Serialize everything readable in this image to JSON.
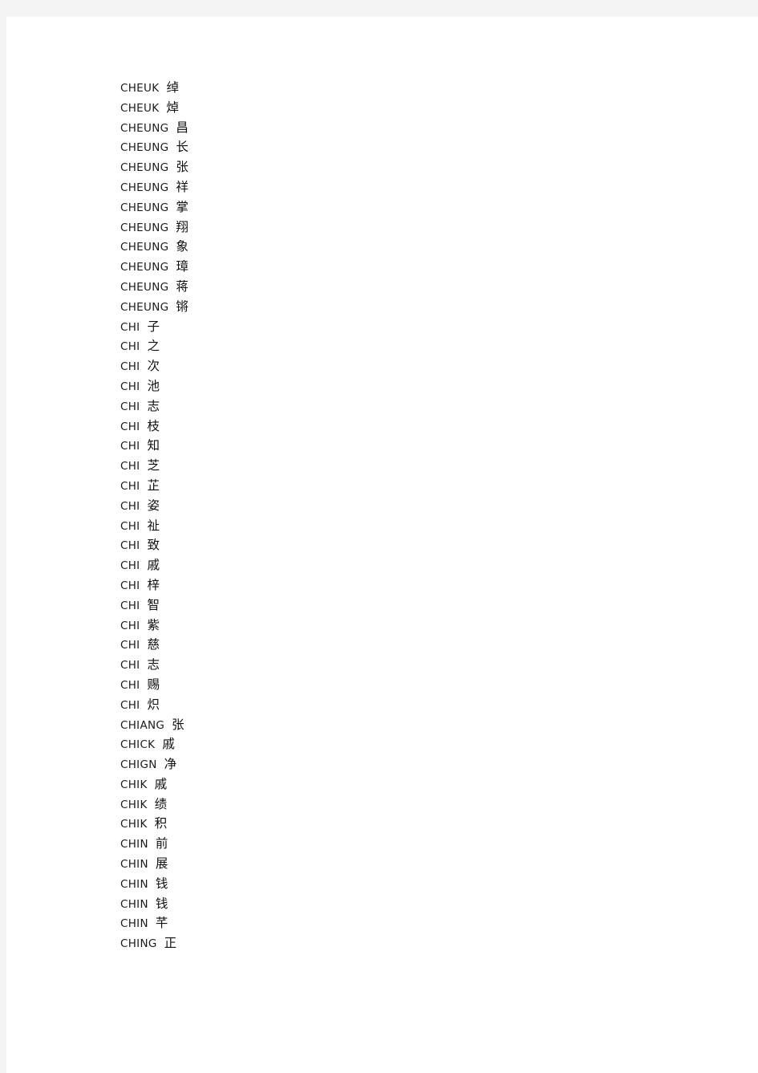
{
  "page": {
    "background_color": "#f4f4f4",
    "paper_color": "#ffffff",
    "text_color": "#1a1a1a"
  },
  "list": {
    "entries": [
      {
        "romanization": "CHEUK",
        "hanzi": "绰"
      },
      {
        "romanization": "CHEUK",
        "hanzi": "焯"
      },
      {
        "romanization": "CHEUNG",
        "hanzi": "昌"
      },
      {
        "romanization": "CHEUNG",
        "hanzi": "长"
      },
      {
        "romanization": "CHEUNG",
        "hanzi": "张"
      },
      {
        "romanization": "CHEUNG",
        "hanzi": "祥"
      },
      {
        "romanization": "CHEUNG",
        "hanzi": "掌"
      },
      {
        "romanization": "CHEUNG",
        "hanzi": "翔"
      },
      {
        "romanization": "CHEUNG",
        "hanzi": "象"
      },
      {
        "romanization": "CHEUNG",
        "hanzi": "璋"
      },
      {
        "romanization": "CHEUNG",
        "hanzi": "蒋"
      },
      {
        "romanization": "CHEUNG",
        "hanzi": "锵"
      },
      {
        "romanization": "CHI",
        "hanzi": "子"
      },
      {
        "romanization": "CHI",
        "hanzi": "之"
      },
      {
        "romanization": "CHI",
        "hanzi": "次"
      },
      {
        "romanization": "CHI",
        "hanzi": "池"
      },
      {
        "romanization": "CHI",
        "hanzi": "志"
      },
      {
        "romanization": "CHI",
        "hanzi": "枝"
      },
      {
        "romanization": "CHI",
        "hanzi": "知"
      },
      {
        "romanization": "CHI",
        "hanzi": "芝"
      },
      {
        "romanization": "CHI",
        "hanzi": "芷"
      },
      {
        "romanization": "CHI",
        "hanzi": "姿"
      },
      {
        "romanization": "CHI",
        "hanzi": "祉"
      },
      {
        "romanization": "CHI",
        "hanzi": "致"
      },
      {
        "romanization": "CHI",
        "hanzi": "戚"
      },
      {
        "romanization": "CHI",
        "hanzi": "梓"
      },
      {
        "romanization": "CHI",
        "hanzi": "智"
      },
      {
        "romanization": "CHI",
        "hanzi": "紫"
      },
      {
        "romanization": "CHI",
        "hanzi": "慈"
      },
      {
        "romanization": "CHI",
        "hanzi": "志"
      },
      {
        "romanization": "CHI",
        "hanzi": "赐"
      },
      {
        "romanization": "CHI",
        "hanzi": "炽"
      },
      {
        "romanization": "CHIANG",
        "hanzi": "张"
      },
      {
        "romanization": "CHICK",
        "hanzi": "戚"
      },
      {
        "romanization": "CHIGN",
        "hanzi": "净"
      },
      {
        "romanization": "CHIK",
        "hanzi": "戚"
      },
      {
        "romanization": "CHIK",
        "hanzi": "绩"
      },
      {
        "romanization": "CHIK",
        "hanzi": "积"
      },
      {
        "romanization": "CHIN",
        "hanzi": "前"
      },
      {
        "romanization": "CHIN",
        "hanzi": "展"
      },
      {
        "romanization": "CHIN",
        "hanzi": "钱"
      },
      {
        "romanization": "CHIN",
        "hanzi": "钱"
      },
      {
        "romanization": "CHIN",
        "hanzi": "芊"
      },
      {
        "romanization": "CHING",
        "hanzi": "正"
      }
    ]
  }
}
